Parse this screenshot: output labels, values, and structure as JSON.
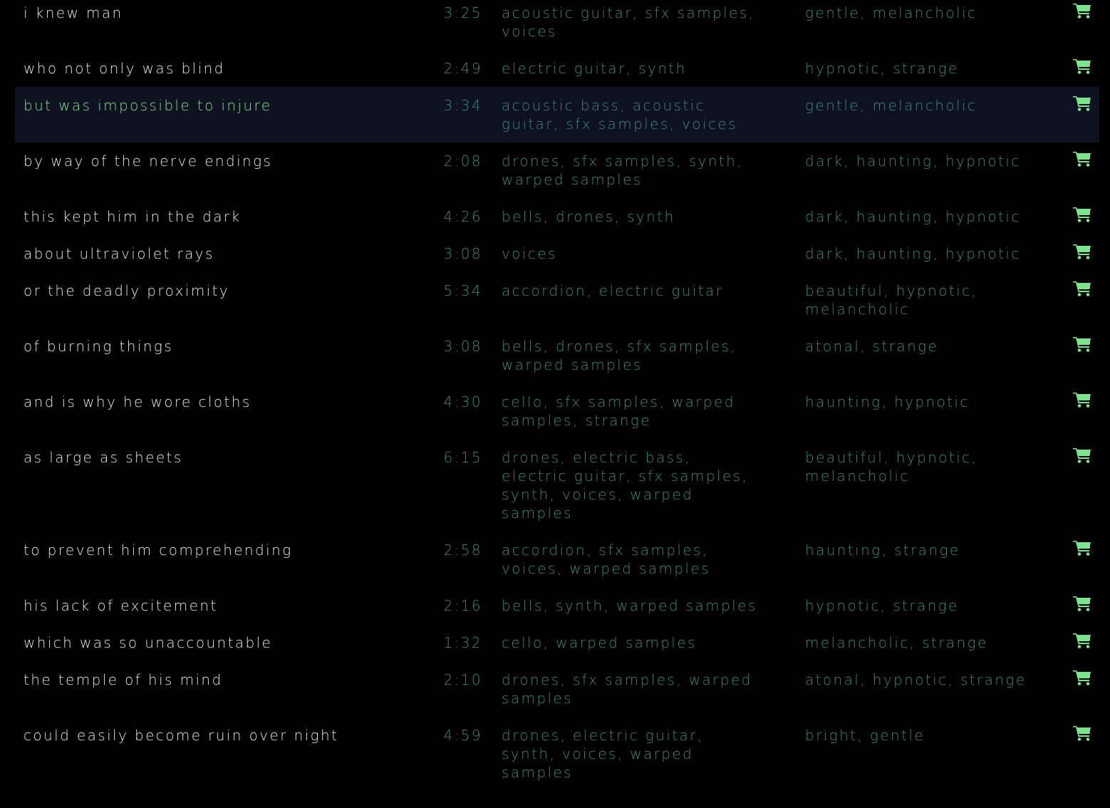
{
  "accent_color": "#7de38f",
  "tag_color": "#3a8a78",
  "highlight_bg": "#0e1220",
  "cart_icon": "shopping-cart-icon",
  "tracks": [
    {
      "title": "i knew man",
      "duration": "3:25",
      "instruments": "acoustic guitar, sfx samples, voices",
      "moods": "gentle, melancholic"
    },
    {
      "title": "who not only was blind",
      "duration": "2:49",
      "instruments": "electric guitar, synth",
      "moods": "hypnotic, strange"
    },
    {
      "title": "but was impossible to injure",
      "duration": "3:34",
      "instruments": "acoustic bass, acoustic guitar, sfx samples, voices",
      "moods": "gentle, melancholic",
      "active": true
    },
    {
      "title": "by way of the nerve endings",
      "duration": "2:08",
      "instruments": "drones, sfx samples, synth, warped samples",
      "moods": "dark, haunting, hypnotic"
    },
    {
      "title": "this kept him in the dark",
      "duration": "4:26",
      "instruments": "bells, drones, synth",
      "moods": "dark, haunting, hypnotic"
    },
    {
      "title": "about ultraviolet rays",
      "duration": "3:08",
      "instruments": "voices",
      "moods": "dark, haunting, hypnotic"
    },
    {
      "title": "or the deadly proximity",
      "duration": "5:34",
      "instruments": "accordion, electric guitar",
      "moods": "beautiful, hypnotic, melancholic"
    },
    {
      "title": "of burning things",
      "duration": "3:08",
      "instruments": "bells, drones, sfx samples, warped samples",
      "moods": "atonal, strange"
    },
    {
      "title": "and is why he wore cloths",
      "duration": "4:30",
      "instruments": "cello, sfx samples, warped samples, strange",
      "moods": "haunting, hypnotic"
    },
    {
      "title": "as large as sheets",
      "duration": "6:15",
      "instruments": "drones, electric bass, electric guitar, sfx samples, synth, voices, warped samples",
      "moods": "beautiful, hypnotic, melancholic"
    },
    {
      "title": "to prevent him comprehending",
      "duration": "2:58",
      "instruments": "accordion, sfx samples, voices, warped samples",
      "moods": "haunting, strange"
    },
    {
      "title": "his lack of excitement",
      "duration": "2:16",
      "instruments": "bells, synth, warped samples",
      "moods": "hypnotic, strange"
    },
    {
      "title": "which was so unaccountable",
      "duration": "1:32",
      "instruments": "cello, warped samples",
      "moods": "melancholic, strange"
    },
    {
      "title": "the temple of his mind",
      "duration": "2:10",
      "instruments": "drones, sfx samples, warped samples",
      "moods": "atonal, hypnotic, strange"
    },
    {
      "title": "could easily become ruin over night",
      "duration": "4:59",
      "instruments": "drones, electric guitar, synth, voices, warped samples",
      "moods": "bright, gentle"
    }
  ]
}
